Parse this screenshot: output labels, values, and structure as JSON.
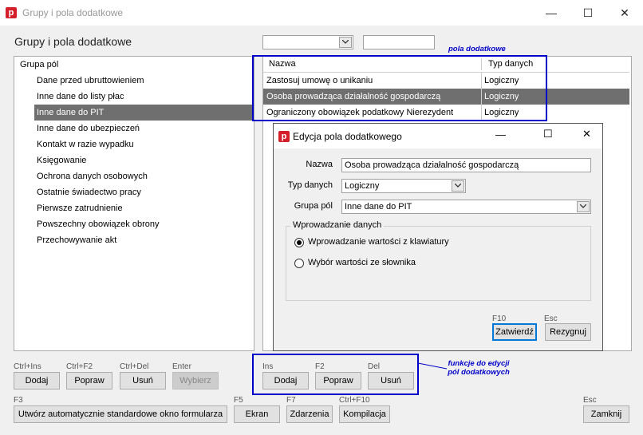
{
  "window": {
    "title": "Grupy i pola dodatkowe",
    "minimize": "—",
    "maximize": "☐",
    "close": "✕",
    "app_icon": "p"
  },
  "header": {
    "title": "Grupy i pola dodatkowe"
  },
  "groups": {
    "header": "Grupa pól",
    "items": [
      "Dane przed ubruttowieniem",
      "Inne dane do listy płac",
      "Inne dane do PIT",
      "Inne dane do ubezpieczeń",
      "Kontakt w razie wypadku",
      "Księgowanie",
      "Ochrona danych osobowych",
      "Ostatnie świadectwo pracy",
      "Pierwsze zatrudnienie",
      "Powszechny obowiązek obrony",
      "Przechowywanie akt"
    ],
    "selected_index": 2
  },
  "fields": {
    "annotation": "pola dodatkowe",
    "columns": [
      "Nazwa",
      "Typ danych"
    ],
    "rows": [
      {
        "name": "Zastosuj umowę o unikaniu",
        "type": "Logiczny"
      },
      {
        "name": "Osoba prowadząca działalność gospodarczą",
        "type": "Logiczny"
      },
      {
        "name": "Ograniczony obowiązek podatkowy Nierezydent",
        "type": "Logiczny"
      }
    ],
    "selected_index": 1
  },
  "left_buttons": [
    {
      "key": "Ctrl+Ins",
      "label": "Dodaj"
    },
    {
      "key": "Ctrl+F2",
      "label": "Popraw"
    },
    {
      "key": "Ctrl+Del",
      "label": "Usuń"
    },
    {
      "key": "Enter",
      "label": "Wybierz",
      "disabled": true
    }
  ],
  "right_buttons": [
    {
      "key": "Ins",
      "label": "Dodaj"
    },
    {
      "key": "F2",
      "label": "Popraw"
    },
    {
      "key": "Del",
      "label": "Usuń"
    }
  ],
  "right_annotation": {
    "line1": "funkcje do edycji",
    "line2": "pól dodatkowych"
  },
  "bottom_buttons": [
    {
      "key": "F3",
      "label": "Utwórz automatycznie standardowe okno formularza"
    },
    {
      "key": "F5",
      "label": "Ekran"
    },
    {
      "key": "F7",
      "label": "Zdarzenia"
    },
    {
      "key": "Ctrl+F10",
      "label": "Kompilacja"
    },
    {
      "key": "Esc",
      "label": "Zamknij"
    }
  ],
  "dialog": {
    "title": "Edycja pola dodatkowego",
    "app_icon": "p",
    "name_label": "Nazwa",
    "name_value": "Osoba prowadząca działalność gospodarczą",
    "type_label": "Typ danych",
    "type_value": "Logiczny",
    "group_label": "Grupa pól",
    "group_value": "Inne dane do PIT",
    "input_group_label": "Wprowadzanie danych",
    "radio_keyboard": "Wprowadzanie wartości z klawiatury",
    "radio_dictionary": "Wybór wartości ze słownika",
    "ok_key": "F10",
    "ok_label": "Zatwierdź",
    "cancel_key": "Esc",
    "cancel_label": "Rezygnuj"
  }
}
